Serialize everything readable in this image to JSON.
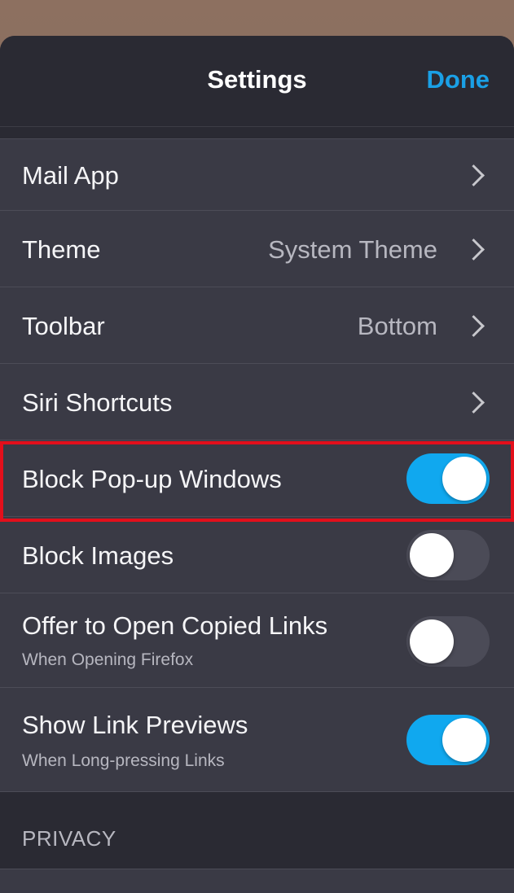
{
  "nav": {
    "title": "Settings",
    "done_label": "Done"
  },
  "rows": [
    {
      "label": "Mail App",
      "type": "disclosure"
    },
    {
      "label": "Theme",
      "value": "System Theme",
      "type": "disclosure"
    },
    {
      "label": "Toolbar",
      "value": "Bottom",
      "type": "disclosure"
    },
    {
      "label": "Siri Shortcuts",
      "type": "disclosure"
    },
    {
      "label": "Block Pop-up Windows",
      "type": "toggle",
      "on": true,
      "highlighted": true
    },
    {
      "label": "Block Images",
      "type": "toggle",
      "on": false
    },
    {
      "label": "Offer to Open Copied Links",
      "sublabel": "When Opening Firefox",
      "type": "toggle",
      "on": false
    },
    {
      "label": "Show Link Previews",
      "sublabel": "When Long-pressing Links",
      "type": "toggle",
      "on": true
    }
  ],
  "sections": {
    "privacy_header": "PRIVACY"
  },
  "colors": {
    "accent": "#1aa0e6",
    "toggle_on": "#10a8ef",
    "highlight": "#e30f1b"
  }
}
